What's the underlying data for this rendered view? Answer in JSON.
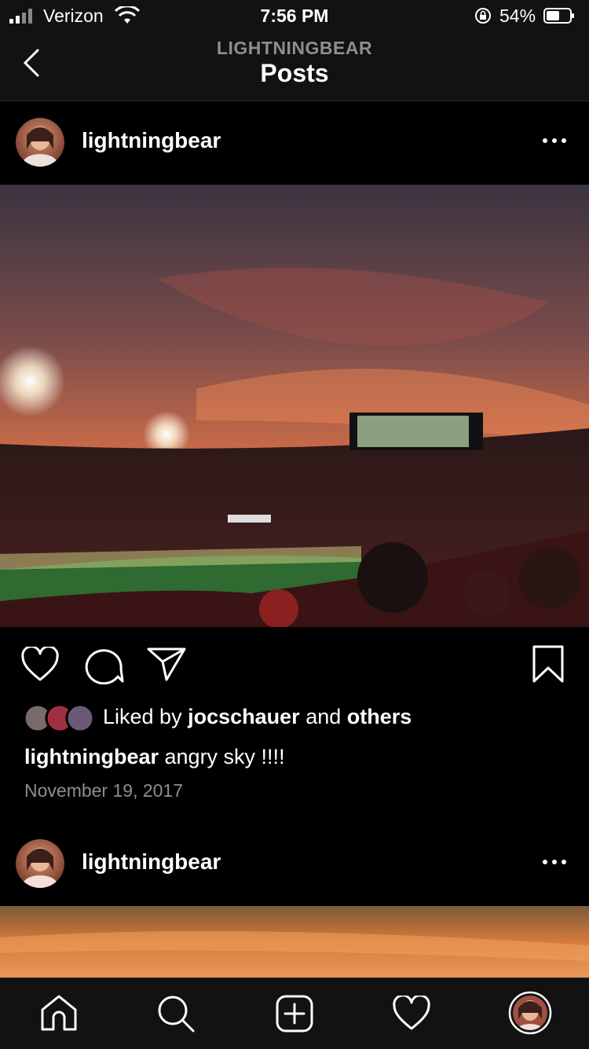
{
  "status_bar": {
    "carrier": "Verizon",
    "time": "7:56 PM",
    "battery": "54%"
  },
  "header": {
    "subtitle": "LIGHTNINGBEAR",
    "title": "Posts"
  },
  "posts": [
    {
      "username": "lightningbear",
      "liked_by_prefix": "Liked by",
      "liked_by_user": "jocschauer",
      "liked_by_and": "and",
      "liked_by_others": "others",
      "caption_user": "lightningbear",
      "caption_text": "angry sky !!!!",
      "date": "November 19, 2017"
    },
    {
      "username": "lightningbear"
    }
  ],
  "icons": [
    "back-icon",
    "more-icon",
    "heart-icon",
    "comment-icon",
    "share-icon",
    "bookmark-icon",
    "home-icon",
    "search-icon",
    "new-post-icon",
    "activity-icon",
    "profile-icon"
  ],
  "colors": {
    "background": "#000000",
    "bar": "#121212",
    "secondary_text": "#8e8e8e"
  }
}
